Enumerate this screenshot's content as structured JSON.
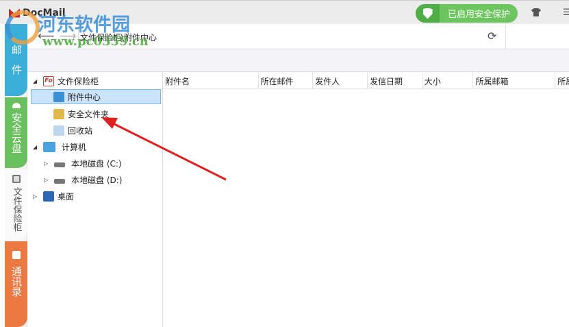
{
  "app": {
    "title": "DocMail",
    "protect_label": "已启用安全保护"
  },
  "tabs": [
    {
      "label": "邮件"
    },
    {
      "label": "安全云盘"
    },
    {
      "label": "文件保险柜"
    },
    {
      "label": "通讯录"
    }
  ],
  "nav": {
    "path": "文件保险柜\\附件中心"
  },
  "tree": {
    "root": "文件保险柜",
    "items": [
      "附件中心",
      "安全文件夹",
      "回收站"
    ],
    "computer": "计算机",
    "drives": [
      "本地磁盘 (C:)",
      "本地磁盘 (D:)"
    ],
    "desktop": "桌面"
  },
  "columns": [
    "附件名",
    "所在邮件",
    "发件人",
    "发信日期",
    "大小",
    "所属邮箱",
    "所属"
  ],
  "watermark": {
    "title": "河东软件园",
    "url": "www.pc0359.cn"
  },
  "colors": {
    "mail": "#3badd9",
    "cloud": "#6abf5e",
    "contacts": "#ec7842",
    "protect": "#6cc55f"
  }
}
